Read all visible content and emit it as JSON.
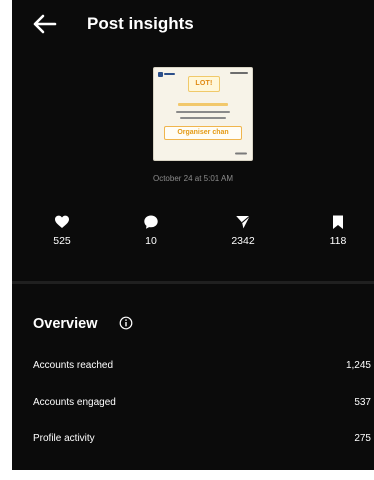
{
  "header": {
    "title": "Post insights"
  },
  "post": {
    "date": "October 24 at 5:01 AM",
    "thumbnail": {
      "badge": "LOT!",
      "answer": "Organiser chan"
    }
  },
  "metrics": [
    {
      "icon": "heart-icon",
      "value": "525"
    },
    {
      "icon": "comment-icon",
      "value": "10"
    },
    {
      "icon": "share-icon",
      "value": "2342"
    },
    {
      "icon": "bookmark-icon",
      "value": "118"
    }
  ],
  "overview": {
    "title": "Overview",
    "rows": [
      {
        "label": "Accounts reached",
        "value": "1,245"
      },
      {
        "label": "Accounts engaged",
        "value": "537"
      },
      {
        "label": "Profile activity",
        "value": "275"
      }
    ]
  },
  "colors": {
    "background": "#0b0b0b",
    "text": "#ffffff",
    "muted": "#8c8c8c",
    "accent": "#e08a10"
  }
}
